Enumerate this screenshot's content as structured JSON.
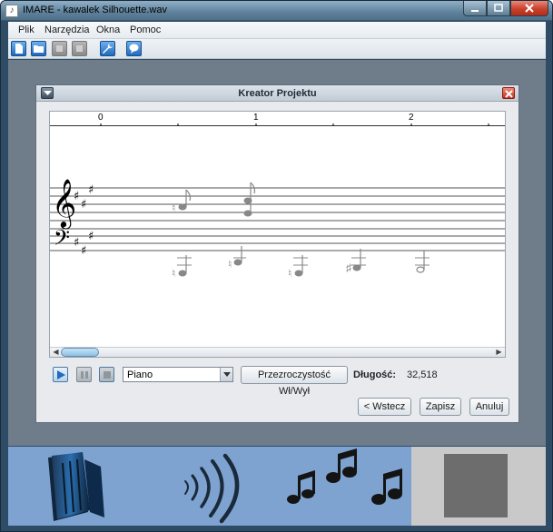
{
  "window": {
    "title": "IMARE - kawalek Silhouette.wav"
  },
  "menu": [
    "Plik",
    "Narzędzia",
    "Okna",
    "Pomoc"
  ],
  "dialog": {
    "title": "Kreator Projektu",
    "ruler_labels": [
      "0",
      "1",
      "2"
    ],
    "instrument": "Piano",
    "transparency_button": "Przezroczystość Wł/Wył",
    "length_label": "Długość:",
    "length_value": "32,518",
    "back_button": "< Wstecz",
    "save_button": "Zapisz",
    "cancel_button": "Anuluj"
  },
  "icons": {
    "toolbar": [
      "new-file-icon",
      "open-folder-icon",
      "disabled-icon",
      "disabled-icon",
      "wrench-icon",
      "help-icon"
    ],
    "dock": [
      "audio-panel-icon",
      "sound-waves-icon",
      "music-notes-icon",
      "blank-square-icon"
    ]
  },
  "colors": {
    "accent": "#1f6bbf",
    "dock_background": "#7ea3d1"
  }
}
